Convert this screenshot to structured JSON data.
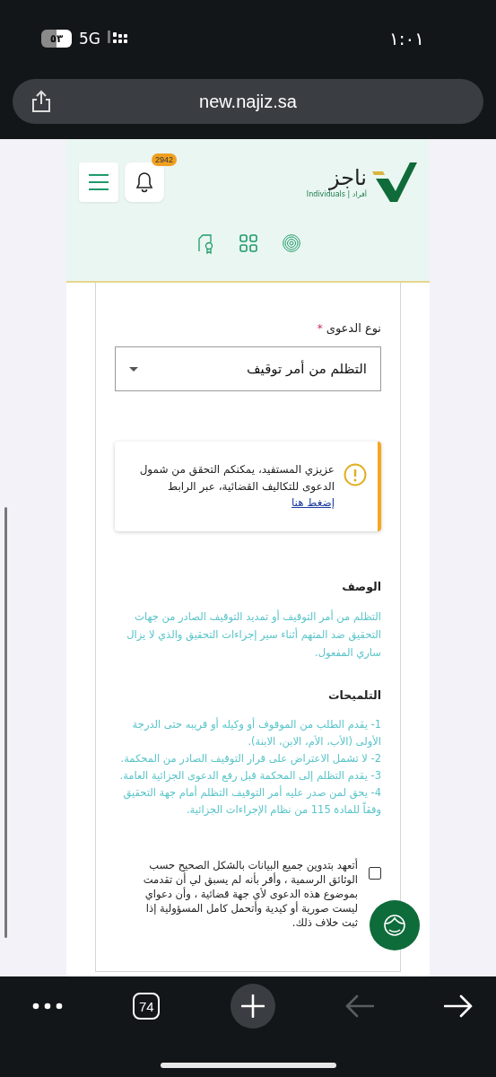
{
  "status_bar": {
    "battery": "٥٣",
    "network": "5G",
    "time": "١:٠١"
  },
  "browser": {
    "url": "new.najiz.sa"
  },
  "header": {
    "logo": {
      "name": "ناجز",
      "subtitle": "Individuals | أفراد"
    },
    "notification_count": "2942"
  },
  "form": {
    "field": {
      "label": "نوع الدعوى",
      "required_mark": "*",
      "value": "التظلم من أمر توقيف"
    },
    "alert": {
      "text": "عزيزي المستفيد، يمكنكم التحقق من شمول الدعوى للتكاليف القضائية، عبر الرابط",
      "link": "إضغط هنا"
    },
    "description": {
      "title": "الوصف",
      "text": "التظلم من أمر التوقيف أو تمديد التوقيف الصادر من جهات التحقيق ضد المتهم أثناء سير إجراءات التحقيق والذي لا يزال ساري المفعول."
    },
    "hints": {
      "title": "التلميحات",
      "items": [
        "1- يقدم الطلب من الموقوف أو وكيله أو قريبه حتى الدرجة الأولى (الأب، الأم، الابن، الابنة).",
        "2- لا تشمل الاعتراض على قرار التوقيف الصادر من المحكمة.",
        "3- يقدم التظلم إلى المحكمة قبل رفع الدعوى الجزائية العامة.",
        "4- يحق لمن صدر عليه أمر التوقيف التظلم أمام جهة التحقيق وفقاً للمادة 115 من نظام الإجراءات الجزائية."
      ]
    },
    "agreement": {
      "text": "أتعهد بتدوين جميع البيانات بالشكل الصحيح حسب الوثائق الرسمية ، وأقر بأنه لم يسبق لي أن تقدمت بموضوع هذه الدعوى لأي جهة قضائية ، وأن دعواي ليست صورية أو كيدية وأتحمل كامل المسؤولية إذا ثبت خلاف ذلك.",
      "checked": false
    }
  },
  "toolbar": {
    "tab_count": "74",
    "back_enabled": false,
    "forward_enabled": true
  }
}
